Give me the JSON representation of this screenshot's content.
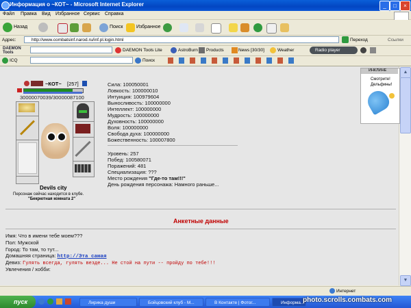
{
  "window": {
    "title": "Информация о ~КОТ~ - Microsoft Internet Explorer"
  },
  "menu": [
    "Файл",
    "Правка",
    "Вид",
    "Избранное",
    "Сервис",
    "Справка"
  ],
  "toolbar": {
    "back_label": "Назад",
    "search_label": "Поиск",
    "favorites_label": "Избранное"
  },
  "address": {
    "label": "Адрес:",
    "url": "http://www.combatsinf.narod.ru/inf.pl.login.html",
    "go_label": "Переход",
    "links_label": "Ссылки"
  },
  "daemonbar": {
    "brand": "DAEMON Tools",
    "daemon_lite": "DAEMON Tools Lite",
    "astroburn": "AstroBurn",
    "products": "Products",
    "news": "News [30/30]",
    "weather": "Weather",
    "radio": "Radio player"
  },
  "icqbar": {
    "icq": "ICQ",
    "search": "Поиск"
  },
  "character": {
    "name": "~КОТ~",
    "level_badge": "[257]",
    "hp": "30000070039/30000087100",
    "city": "Devils city",
    "location_line1": "Персонаж сейчас находится в клубе.",
    "location_line2": "\"Бекрютная комната 2\"",
    "hp_fraction": 0.82
  },
  "stats": [
    "Сила: 100050001",
    "Ловкость: 100000010",
    "Интуиция: 100979604",
    "Выносливость: 100000000",
    "Интеллект: 100000000",
    "Мудрость: 100000000",
    "Духовность: 100000000",
    "Воля: 100000000",
    "Свобода духа: 100000000",
    "Божественность: 100007800"
  ],
  "info": [
    "Уровень: 257",
    "Побед: 100580071",
    "Поражений: 481",
    "Специализация: ???"
  ],
  "birthplace": {
    "label": "Место рождения ",
    "value": "\"Где-то там!!!\""
  },
  "birthday": "День рождения персонажа: Намного раньше...",
  "ad": {
    "header": "ИНКЛИНЕ",
    "text1": "Смотрите!",
    "text2": "Дельфины!"
  },
  "profile": {
    "heading": "Анкетные данные",
    "name_line": "Имя: Что в имени тебе моем???",
    "gender_line": "Пол: Мужской",
    "city_line": "Город: То там, то тут...",
    "homepage_label": "Домашняя страница: ",
    "homepage_link": "http://Эта самая",
    "motto_label": "Девиз: ",
    "motto_value": "Гулять всегда, гулять везде... Не стой на пути -- пройду по тебе!!!",
    "hobbies_line": "Увлечения / хобби:"
  },
  "status": {
    "zone": "Интернет"
  },
  "taskbar": {
    "start": "пуск",
    "tasks": [
      "Лирика души",
      "Бойцовский клуб - M...",
      "В Контакте | Фотог...",
      "Информа..."
    ]
  },
  "watermark": "photo.scrolls.combats.com",
  "colors": {
    "accent_red": "#c00000",
    "link_blue": "#1a3fc1",
    "hp_green": "#1f8e1f"
  }
}
